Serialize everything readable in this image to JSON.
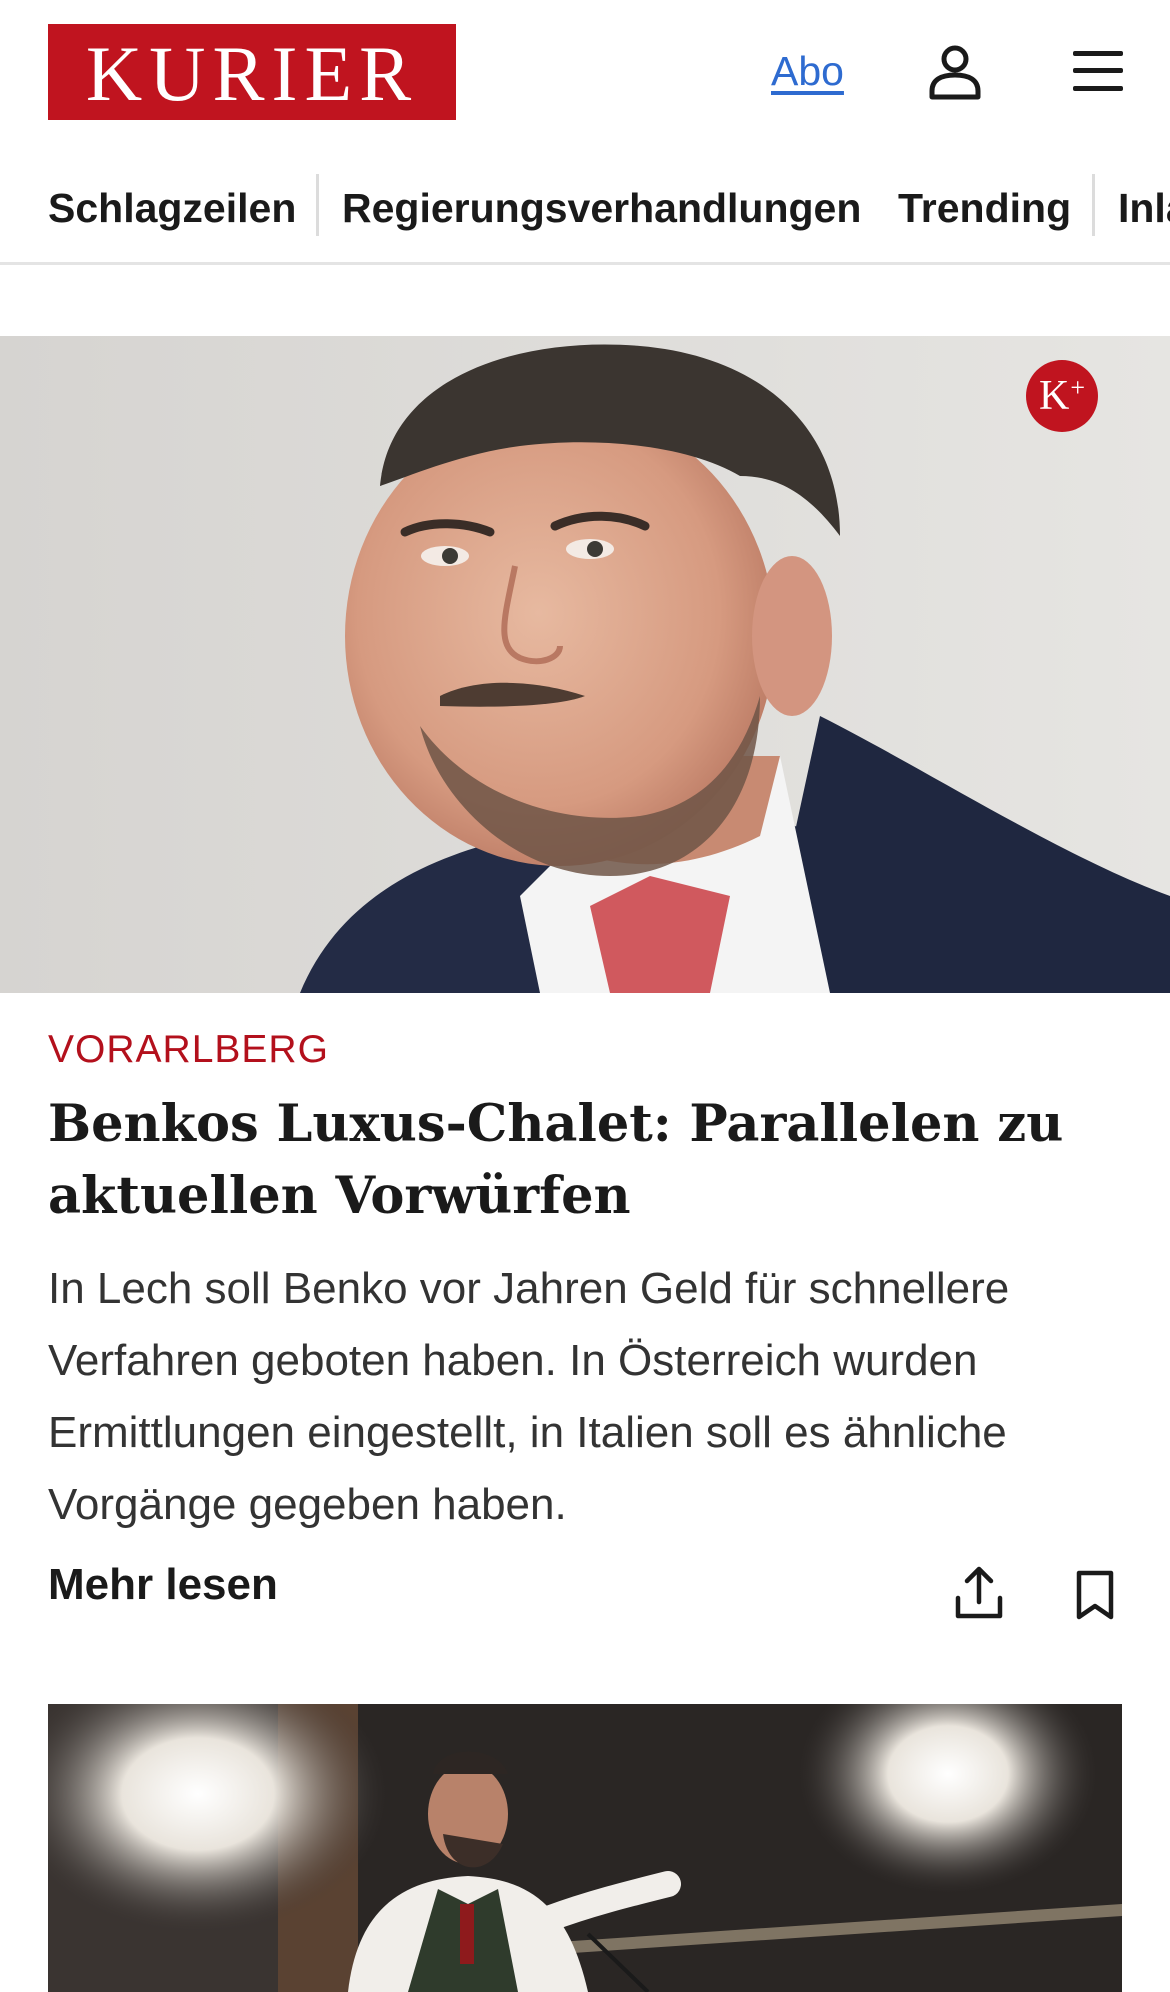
{
  "header": {
    "logo_text": "KURIER",
    "abo_label": "Abo",
    "icons": {
      "user": "user-icon",
      "menu": "menu-icon"
    }
  },
  "nav": {
    "items": [
      {
        "label": "Schlagzeilen"
      },
      {
        "label": "Regierungsverhandlungen"
      },
      {
        "label": "Trending"
      },
      {
        "label": "Inland"
      }
    ]
  },
  "article": {
    "badge": "K",
    "badge_plus": "+",
    "kicker": "VORARLBERG",
    "headline": "Benkos Luxus-Chalet: Parallelen zu aktu­ellen Vorwürfen",
    "teaser": "In Lech soll Benko vor Jahren Geld für schnellere Verfahren geboten haben. In Österreich wurden Ermittlungen eingestellt, in Italien soll es ähnliche Vorgänge gegeben haben.",
    "more_label": "Mehr lesen",
    "icons": {
      "share": "share-icon",
      "bookmark": "bookmark-icon"
    }
  },
  "colors": {
    "brand_red": "#c0141f",
    "kicker_red": "#b3101c",
    "link_blue": "#2e6bd0"
  }
}
